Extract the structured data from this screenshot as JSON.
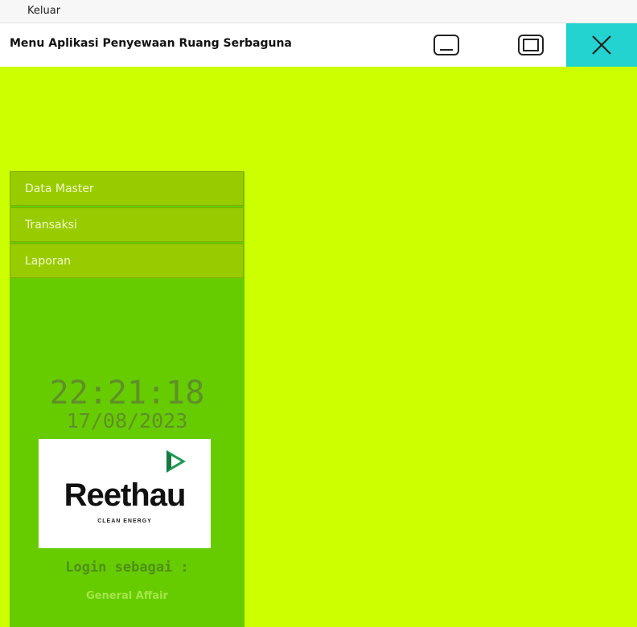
{
  "menubar": {
    "menu_label": "Keluar"
  },
  "titlebar": {
    "title": "Menu Aplikasi Penyewaan Ruang Serbaguna",
    "minimize_icon": "minimize-icon",
    "maximize_icon": "maximize-icon",
    "close_icon": "close-icon",
    "close_bg": "#22d3d0"
  },
  "colors": {
    "main_bg": "#ccff00",
    "sidebar_bg": "#66cc00",
    "nav_bg": "#99cc00"
  },
  "sidebar": {
    "items": [
      {
        "label": "Data Master"
      },
      {
        "label": "Transaksi"
      },
      {
        "label": "Laporan"
      }
    ],
    "clock": "22:21:18",
    "date": "17/08/2023",
    "logo": {
      "name": "Reethau",
      "tagline": "CLEAN ENERGY"
    },
    "login_label": "Login sebagai :",
    "login_user": "General Affair"
  }
}
